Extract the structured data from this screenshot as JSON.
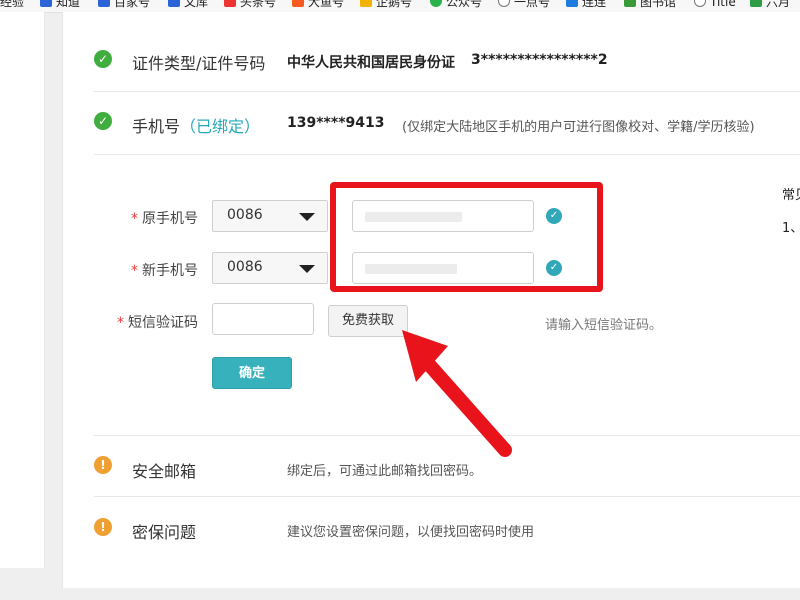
{
  "bookmarks": [
    {
      "label": "经验",
      "icon": "paw-icon",
      "color": "#2b63d9"
    },
    {
      "label": "知道",
      "icon": "paw-icon",
      "color": "#2b63d9"
    },
    {
      "label": "百家号",
      "icon": "paw-icon",
      "color": "#2b63d9"
    },
    {
      "label": "文库",
      "icon": "paw-icon",
      "color": "#2b63d9"
    },
    {
      "label": "头条号",
      "icon": "toutiao-icon",
      "color": "#e33"
    },
    {
      "label": "大鱼号",
      "icon": "fish-icon",
      "color": "#f55a1e"
    },
    {
      "label": "企鹅号",
      "icon": "penguin-icon",
      "color": "#f2b300"
    },
    {
      "label": "公众号",
      "icon": "wechat-icon",
      "color": "#2bb24c"
    },
    {
      "label": "一点号",
      "icon": "globe-icon",
      "color": "#777"
    },
    {
      "label": "连连",
      "icon": "letter-l-icon",
      "color": "#1e7be0"
    },
    {
      "label": "图书馆",
      "icon": "library-icon",
      "color": "#3a9a3a"
    },
    {
      "label": "Title",
      "icon": "globe-icon",
      "color": "#777"
    },
    {
      "label": "六月",
      "icon": "sheet-icon",
      "color": "#2e9d46"
    }
  ],
  "id_row": {
    "title": "证件类型/证件号码",
    "id_type": "中华人民共和国居民身份证",
    "id_number": "3****************2"
  },
  "phone_row": {
    "title": "手机号",
    "status": "（已绑定）",
    "number": "139****9413",
    "note": "(仅绑定大陆地区手机的用户可进行图像校对、学籍/学历核验)"
  },
  "form": {
    "original_label": "原手机号",
    "new_label": "新手机号",
    "sms_label": "短信验证码",
    "required_mark": "*",
    "original_code": "0086",
    "new_code": "0086",
    "get_code_button": "免费获取",
    "sms_hint": "请输入短信验证码。",
    "confirm_button": "确定"
  },
  "side": {
    "line1": "常见",
    "line2": "1、"
  },
  "email_row": {
    "title": "安全邮箱",
    "note": "绑定后，可通过此邮箱找回密码。"
  },
  "security_row": {
    "title": "密保问题",
    "note": "建议您设置密保问题，以便找回密码时使用"
  },
  "colors": {
    "ok": "#3fae3f",
    "warn": "#f0a033",
    "accent": "#37b1bb",
    "highlight": "#e8131b"
  }
}
